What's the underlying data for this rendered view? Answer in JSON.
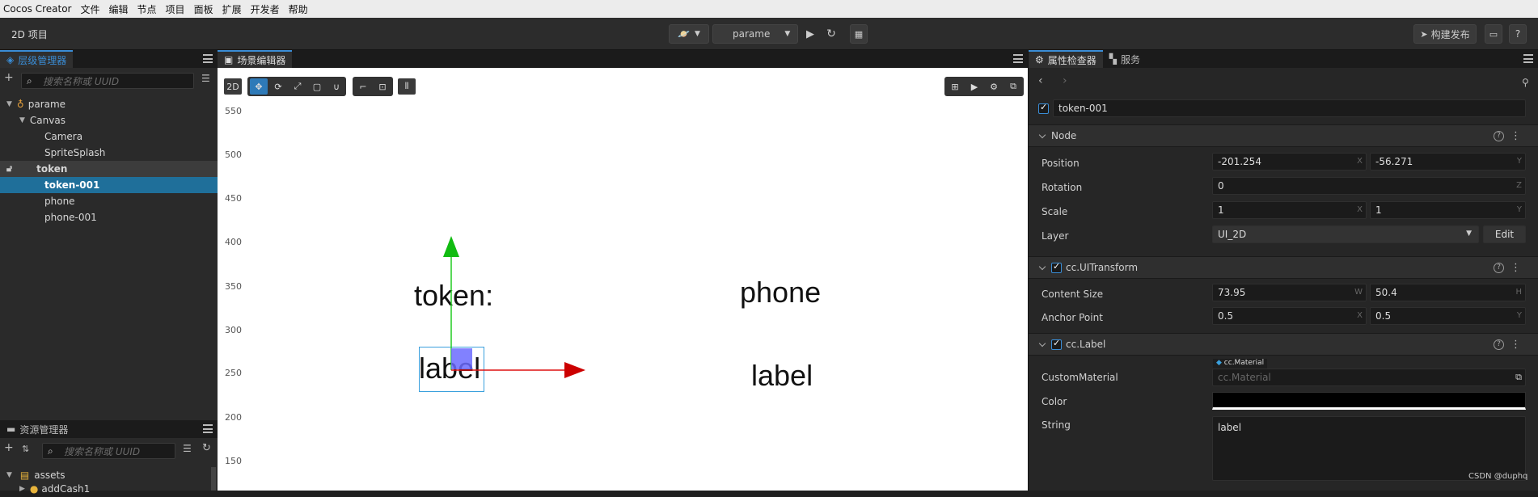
{
  "menubar": {
    "items": [
      "Cocos Creator",
      "文件",
      "编辑",
      "节点",
      "项目",
      "面板",
      "扩展",
      "开发者",
      "帮助"
    ]
  },
  "toolbar": {
    "project": "2D 项目",
    "scene_select": "parame",
    "build_label": "构建发布"
  },
  "hierarchy": {
    "tab": "层级管理器",
    "search_placeholder": "搜索名称或 UUID",
    "nodes": [
      {
        "label": "parame",
        "depth": 0,
        "state": "none"
      },
      {
        "label": "Canvas",
        "depth": 1,
        "state": "none"
      },
      {
        "label": "Camera",
        "depth": 2,
        "state": "none"
      },
      {
        "label": "SpriteSplash",
        "depth": 2,
        "state": "none"
      },
      {
        "label": "token",
        "depth": 2,
        "state": "hl"
      },
      {
        "label": "token-001",
        "depth": 2,
        "state": "sel"
      },
      {
        "label": "phone",
        "depth": 2,
        "state": "none"
      },
      {
        "label": "phone-001",
        "depth": 2,
        "state": "none"
      }
    ]
  },
  "assets": {
    "tab": "资源管理器",
    "search_placeholder": "搜索名称或 UUID",
    "root": "assets",
    "child": "addCash1"
  },
  "scene": {
    "tab": "场景编辑器",
    "mode": "2D",
    "y_ticks": [
      "550",
      "500",
      "450",
      "400",
      "350",
      "300",
      "250",
      "200",
      "150"
    ],
    "labels": {
      "token": "token:",
      "phone": "phone",
      "label_left": "label",
      "label_right": "label"
    }
  },
  "inspector": {
    "tabs": [
      "属性检查器",
      "服务"
    ],
    "node_name": "token-001",
    "node_section": "Node",
    "position": {
      "label": "Position",
      "x": "-201.254",
      "y": "-56.271"
    },
    "rotation": {
      "label": "Rotation",
      "z": "0"
    },
    "scale": {
      "label": "Scale",
      "x": "1",
      "y": "1"
    },
    "layer": {
      "label": "Layer",
      "value": "UI_2D",
      "edit": "Edit"
    },
    "uitransform": {
      "title": "cc.UITransform",
      "content_size_label": "Content Size",
      "w": "73.95",
      "h": "50.4",
      "anchor_label": "Anchor Point",
      "ax": "0.5",
      "ay": "0.5"
    },
    "label_comp": {
      "title": "cc.Label",
      "material_label": "CustomMaterial",
      "material_tag": "cc.Material",
      "material_placeholder": "cc.Material",
      "color_label": "Color",
      "string_label": "String",
      "string_value": "label"
    },
    "axis": {
      "x": "X",
      "y": "Y",
      "z": "Z",
      "w": "W",
      "h": "H"
    }
  },
  "watermark": "CSDN @duphq"
}
